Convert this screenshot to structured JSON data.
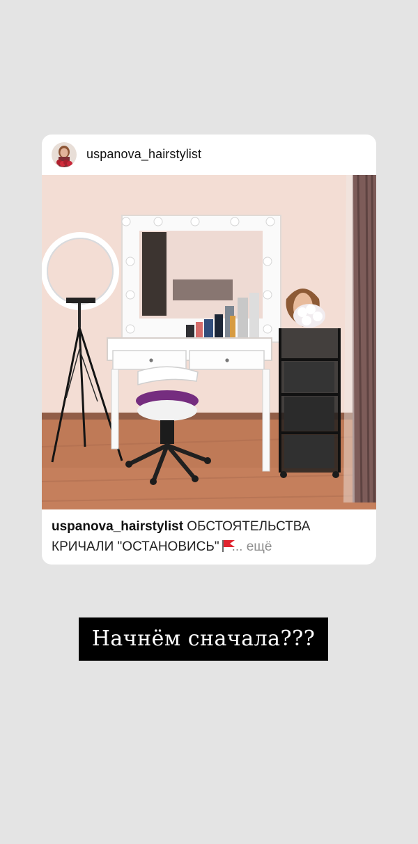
{
  "post": {
    "username": "uspanova_hairstylist",
    "caption_username": "uspanova_hairstylist",
    "caption_text": " ОБСТОЯТЕЛЬСТВА КРИЧАЛИ \"ОСТАНОВИСЬ\"",
    "caption_more": "... ещё",
    "flag_icon": "red-flag-icon"
  },
  "story": {
    "text": "Начнём сначала???"
  },
  "colors": {
    "background": "#e4e4e4",
    "card": "#ffffff",
    "sticker_background": "#000000",
    "sticker_text": "#ffffff",
    "more_text": "#8e8e8e"
  }
}
